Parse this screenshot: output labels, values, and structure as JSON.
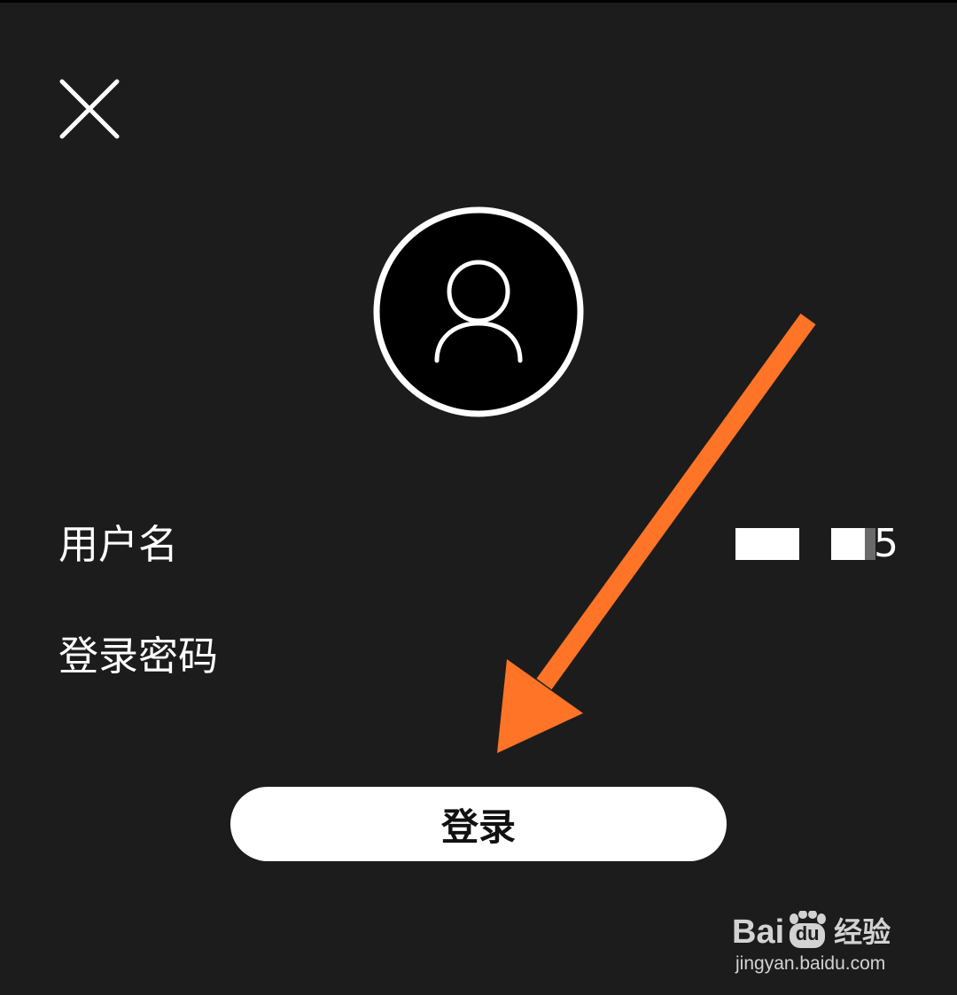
{
  "login": {
    "username_label": "用户名",
    "username_value_tail": "5",
    "password_label": "登录密码",
    "password_value": "",
    "submit_label": "登录"
  },
  "icons": {
    "close": "close-icon",
    "avatar": "user-avatar-icon"
  },
  "watermark": {
    "brand_left": "Bai",
    "brand_paw": "du",
    "brand_cn": "经验",
    "url": "jingyan.baidu.com"
  },
  "colors": {
    "background": "#1c1c1c",
    "accent_arrow": "#ff7426",
    "button_bg": "#ffffff",
    "button_text": "#111111"
  }
}
